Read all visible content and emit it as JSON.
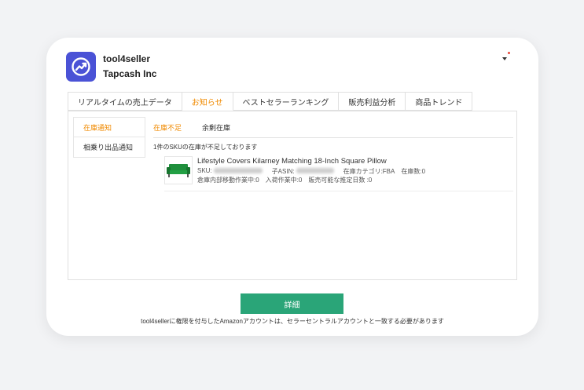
{
  "header": {
    "app_name": "tool4seller",
    "company": "Tapcash Inc",
    "logo_icon": "trend-arrow-icon",
    "logo_color": "#4a52d6"
  },
  "tabs": [
    {
      "label": "リアルタイムの売上データ",
      "active": false
    },
    {
      "label": "お知らせ",
      "active": true
    },
    {
      "label": "ベストセラーランキング",
      "active": false
    },
    {
      "label": "販売利益分析",
      "active": false
    },
    {
      "label": "商品トレンド",
      "active": false
    }
  ],
  "sidebar": {
    "items": [
      {
        "label": "在庫通知",
        "active": true
      },
      {
        "label": "相乗り出品通知",
        "active": false
      }
    ]
  },
  "subtabs": [
    {
      "label": "在庫不足",
      "active": true
    },
    {
      "label": "余剰在庫",
      "active": false
    }
  ],
  "notice": "1件のSKUの在庫が不足しております",
  "product": {
    "title": "Lifestyle Covers Kilarney Matching 18-Inch Square Pillow",
    "sku_label": "SKU:",
    "asin_label": "子ASIN:",
    "category": "在庫カテゴリ:FBA",
    "stock": "在庫数:0",
    "transfer": "倉庫内部移動作業中:0",
    "inbound": "入荷作業中:0",
    "days": "販売可能な推定日数 :0"
  },
  "actions": {
    "detail_label": "詳細"
  },
  "footer": "tool4sellerに権限を付与したAmazonアカウントは、セラーセントラルアカウントと一致する必要があります",
  "colors": {
    "accent": "#f08a00",
    "button": "#2aa578"
  }
}
